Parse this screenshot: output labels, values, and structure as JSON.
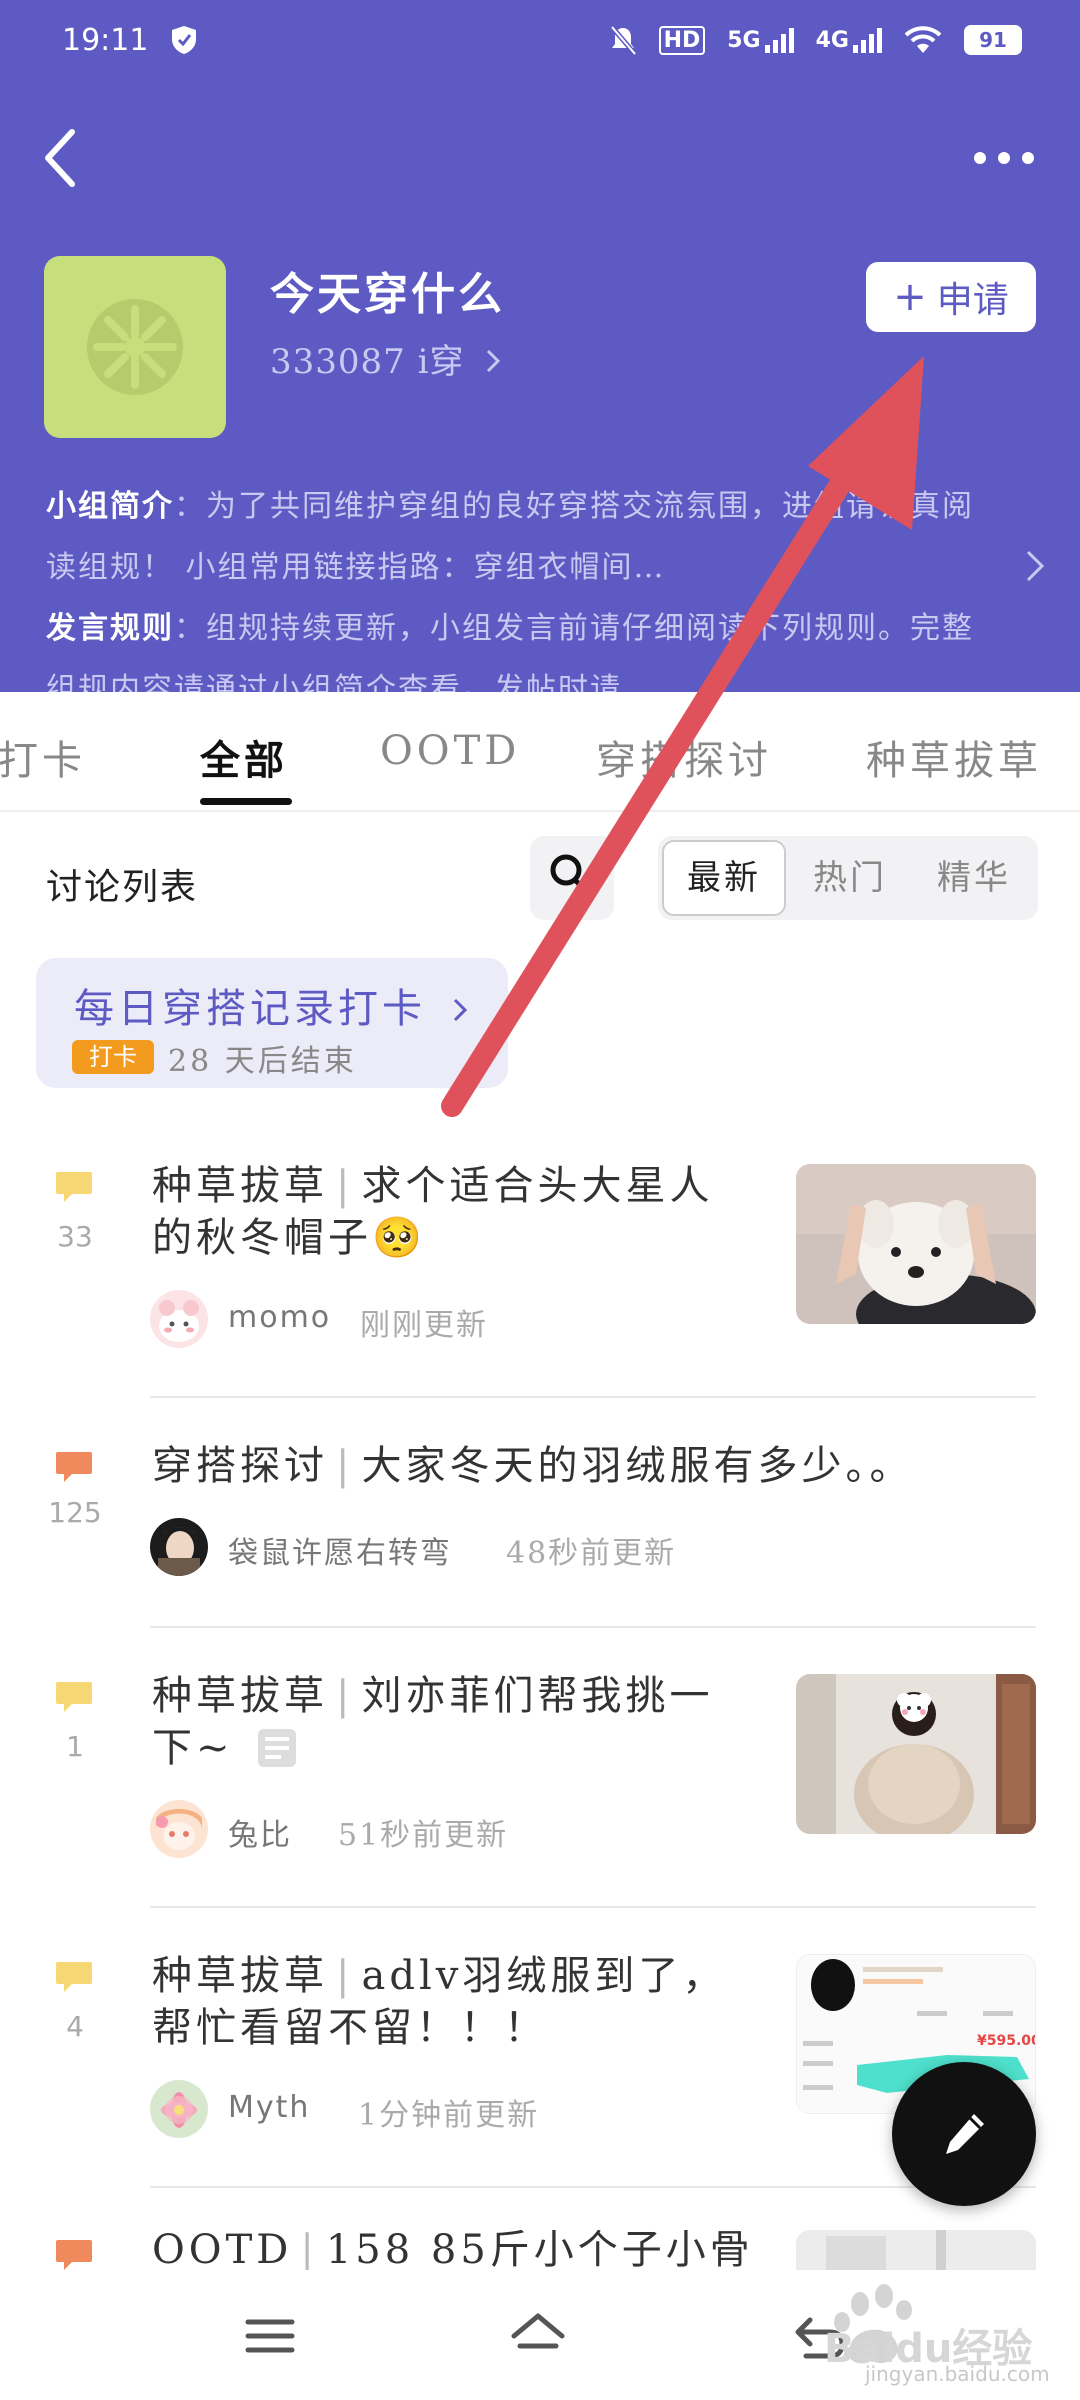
{
  "status_bar": {
    "time": "19:11",
    "network_1": "HD",
    "network_2": "5G",
    "network_3": "4G",
    "battery": "91"
  },
  "header": {
    "title": "今天穿什么",
    "member_count": "333087 i穿",
    "apply_label": "申请",
    "apply_icon": "plus-icon",
    "intro_label": "小组简介",
    "intro_text": "：为了共同维护穿组的良好穿搭交流氛围，进组请认真阅读组规！ 小组常用链接指路：穿组衣帽间…",
    "rules_label": "发言规则",
    "rules_text": "：组规持续更新，小组发言前请仔细阅读下列规则。完整组规内容请通过小组简介查看。发帖时请…",
    "accent_color": "#5d5bc3"
  },
  "tabs": {
    "items": [
      "打卡",
      "全部",
      "OOTD",
      "穿搭探讨",
      "种草拔草"
    ],
    "active": "全部"
  },
  "discussion": {
    "title": "讨论列表",
    "sort_options": [
      "最新",
      "热门",
      "精华"
    ],
    "active_sort": "最新"
  },
  "checkin": {
    "title": "每日穿搭记录打卡",
    "badge": "打卡",
    "end_text": "28 天后结束"
  },
  "posts": [
    {
      "category": "种草拔草",
      "title": "求个适合头大星人的秋冬帽子🥺",
      "replies": "33",
      "author": "momo",
      "time": "刚刚更新",
      "has_thumbnail": true
    },
    {
      "category": "穿搭探讨",
      "title": "大家冬天的羽绒服有多少。。",
      "replies": "125",
      "author": "袋鼠许愿右转弯",
      "time": "48秒前更新",
      "has_thumbnail": false
    },
    {
      "category": "种草拔草",
      "title": "刘亦菲们帮我挑一下~",
      "replies": "1",
      "author": "兔比",
      "time": "51秒前更新",
      "has_thumbnail": true
    },
    {
      "category": "种草拔草",
      "title": "adlv羽绒服到了，帮忙看留不留！！！",
      "replies": "4",
      "author": "Myth",
      "time": "1分钟前更新",
      "has_thumbnail": true,
      "thumbnail_price": "¥595.00"
    },
    {
      "category": "OOTD",
      "title": "158 85斤小个子小骨",
      "has_thumbnail": true
    }
  ],
  "colors": {
    "bubble_yellow": "#f7d774",
    "bubble_orange": "#f08a5d",
    "annotation_red": "#e0525b",
    "badge_orange": "#f39b1f"
  },
  "watermark": {
    "brand": "Baidu经验",
    "url": "jingyan.baidu.com"
  }
}
